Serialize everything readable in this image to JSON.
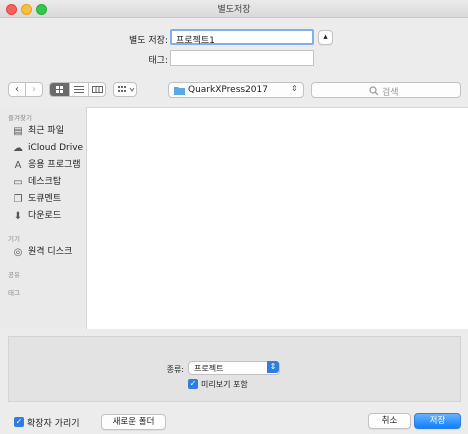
{
  "window": {
    "title": "별도저장"
  },
  "save_form": {
    "save_as_label": "별도 저장:",
    "save_as_value": "프로젝트1",
    "tags_label": "태그:",
    "tags_value": ""
  },
  "toolbar": {
    "location": "QuarkXPress2017",
    "search_placeholder": "검색"
  },
  "sidebar": {
    "favorites_header": "즐겨찾기",
    "favorites": [
      {
        "label": "최근 파일",
        "icon": "recents-icon"
      },
      {
        "label": "iCloud Drive",
        "icon": "cloud-icon"
      },
      {
        "label": "응용 프로그램",
        "icon": "applications-icon"
      },
      {
        "label": "데스크탑",
        "icon": "desktop-icon"
      },
      {
        "label": "도큐멘트",
        "icon": "documents-icon"
      },
      {
        "label": "다운로드",
        "icon": "downloads-icon"
      }
    ],
    "devices_header": "기기",
    "devices": [
      {
        "label": "원격 디스크",
        "icon": "disc-icon"
      }
    ],
    "shared_header": "공유",
    "tags_header": "태그"
  },
  "options": {
    "format_label": "종류:",
    "format_value": "프로젝트",
    "preview_label": "미리보기 포함",
    "preview_checked": true
  },
  "footer": {
    "hide_extension_label": "확장자 가리기",
    "hide_extension_checked": true,
    "new_folder_label": "새로운 폴더",
    "cancel_label": "취소",
    "save_label": "저장"
  },
  "colors": {
    "accent": "#2f7dde",
    "folder": "#5aa9e6"
  }
}
